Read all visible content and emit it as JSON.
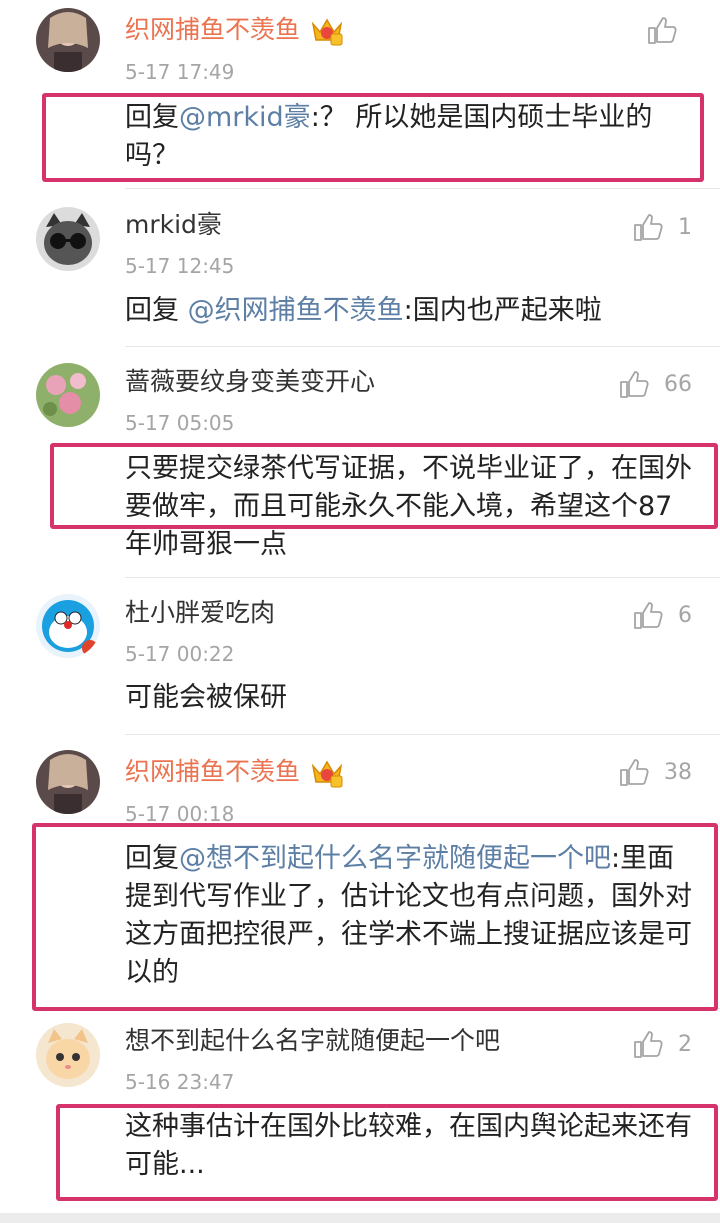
{
  "comments": [
    {
      "name": "织网捕鱼不羡鱼",
      "vip": true,
      "time": "5-17 17:49",
      "like_count": "",
      "reply_prefix": "回复",
      "mention": "@mrkid豪",
      "text": ":？ 所以她是国内硕士毕业的吗？"
    },
    {
      "name": "mrkid豪",
      "vip": false,
      "time": "5-17 12:45",
      "like_count": "1",
      "reply_prefix": "回复 ",
      "mention": "@织网捕鱼不羡鱼",
      "text": ":国内也严起来啦"
    },
    {
      "name": "蔷薇要纹身变美变开心",
      "vip": false,
      "time": "5-17 05:05",
      "like_count": "66",
      "reply_prefix": "",
      "mention": "",
      "text": "只要提交绿茶代写证据，不说毕业证了，在国外要做牢，而且可能永久不能入境，希望这个87年帅哥狠一点"
    },
    {
      "name": "杜小胖爱吃肉",
      "vip": false,
      "time": "5-17 00:22",
      "like_count": "6",
      "reply_prefix": "",
      "mention": "",
      "text": "可能会被保研"
    },
    {
      "name": "织网捕鱼不羡鱼",
      "vip": true,
      "time": "5-17 00:18",
      "like_count": "38",
      "reply_prefix": "回复",
      "mention": "@想不到起什么名字就随便起一个吧",
      "text": ":里面提到代写作业了，估计论文也有点问题，国外对这方面把控很严，往学术不端上搜证据应该是可以的"
    },
    {
      "name": "想不到起什么名字就随便起一个吧",
      "vip": false,
      "time": "5-16 23:47",
      "like_count": "2",
      "reply_prefix": "",
      "mention": "",
      "text": "这种事估计在国外比较难，在国内舆论起来还有可能..."
    }
  ],
  "colors": {
    "vip_name": "#eb7350",
    "mention": "#5d7fa6",
    "highlight_box": "#d6336c",
    "muted": "#a5a5a5"
  },
  "icons": {
    "like": "thumbs-up-icon",
    "vip": "crown-badge-icon"
  }
}
